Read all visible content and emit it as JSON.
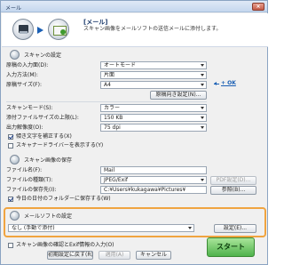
{
  "window": {
    "title": "メール",
    "close": "×"
  },
  "header": {
    "title": "[メール]",
    "description": "スキャン画像をメールソフトの送信メールに添付します。"
  },
  "scan_settings": {
    "section_title": "スキャンの設定",
    "source_label": "原稿の入力面(D):",
    "source_value": "オートモード",
    "input_method_label": "入力方法(M):",
    "input_method_value": "片面",
    "size_label": "原稿サイズ(F):",
    "size_value": "A4",
    "size_detail_button": "原稿向き設定(N)...",
    "ratio_label": "+ OK",
    "mode_label": "スキャンモード(S):",
    "mode_value": "カラー",
    "file_size_label": "添付ファイルサイズの上限(L):",
    "file_size_value": "150 KB",
    "resolution_label": "出力解像度(O):",
    "resolution_value": "75 dpi",
    "deskew_label": "傾き文字を補正する(X)",
    "driver_label": "スキャナードライバーを表示する(Y)"
  },
  "save_settings": {
    "section_title": "スキャン画像の保存",
    "filename_label": "ファイル名(F):",
    "filename_value": "Mail",
    "type_label": "ファイルの種類(T):",
    "type_value": "JPEG/Exif",
    "pdf_button": "PDF設定(D)...",
    "location_label": "ファイルの保存先(I):",
    "location_value": "C:¥Users¥kukagawa¥Pictures¥",
    "browse_button": "参照(B)...",
    "subfolder_label": "今日の日付のフォルダーに保存する(W)"
  },
  "mail_settings": {
    "section_title": "メールソフトの設定",
    "app_value": "なし (手動で添付)",
    "settings_button": "設定(E)..."
  },
  "bottom": {
    "confirm_label": "スキャン画像の確認とExif情報の入力(O)",
    "reset_button": "初期設定に戻す(R)",
    "apply_button": "適用(A)",
    "cancel_button": "キャンセル",
    "start_button": "スタート"
  }
}
